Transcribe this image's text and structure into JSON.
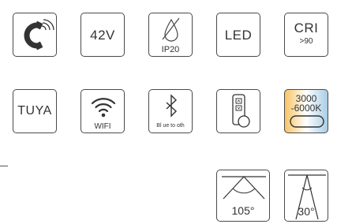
{
  "icons": [
    {
      "name": "magnet-icon"
    },
    {
      "label": "42V"
    },
    {
      "label": "IP20",
      "icon": "waterdrop-crossed-icon"
    },
    {
      "label": "LED"
    },
    {
      "title": "CRI",
      "sub": ">90"
    },
    {
      "label": "TUYA"
    },
    {
      "label": "WIFI",
      "icon": "wifi-icon"
    },
    {
      "label": "Bl ue to oth",
      "icon": "bluetooth-icon"
    },
    {
      "name": "remote-control-icon"
    },
    {
      "line1": "3000",
      "line2": "-6000K",
      "gradient": [
        "#f7c465",
        "#ffffff",
        "#a9cde6"
      ]
    },
    {
      "label": "105°",
      "icon": "beam-angle-105-icon"
    },
    {
      "label": "30°",
      "icon": "beam-angle-30-icon"
    }
  ]
}
